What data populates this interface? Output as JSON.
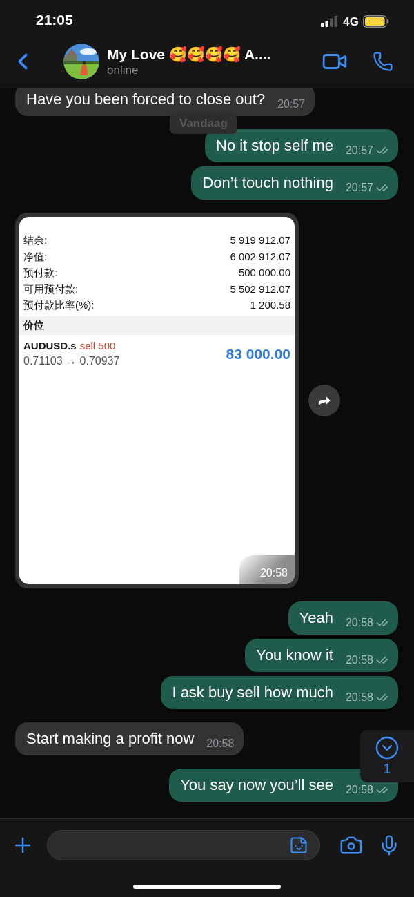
{
  "status_bar": {
    "time": "21:05",
    "network": "4G"
  },
  "header": {
    "name": "My Love 🥰🥰🥰🥰 A....",
    "status": "online"
  },
  "date_chip": "Vandaag",
  "messages": [
    {
      "kind": "text",
      "outgoing": false,
      "text": "Have you been forced to close out?",
      "time": "20:57"
    },
    {
      "kind": "text",
      "outgoing": true,
      "text": "No it stop self me",
      "time": "20:57",
      "read": false
    },
    {
      "kind": "text",
      "outgoing": true,
      "text": "Don’t touch nothing",
      "time": "20:57",
      "read": false
    },
    {
      "outgoing": false,
      "time": "20:58",
      "rows": [
        {
          "label": "结余:",
          "value": "5 919 912.07"
        },
        {
          "label": "净值:",
          "value": "6 002 912.07"
        },
        {
          "label": "预付款:",
          "value": "500 000.00"
        },
        {
          "label": "可用预付款:",
          "value": "5 502 912.07"
        },
        {
          "label": "预付款比率(%):",
          "value": "1 200.58"
        }
      ],
      "section": "价位",
      "position": {
        "symbol": "AUDUSD.s",
        "order": "sell 500",
        "prices": "0.71103 → 0.70937",
        "profit": "83 000.00"
      }
    },
    {
      "kind": "text",
      "outgoing": true,
      "text": "Yeah",
      "time": "20:58",
      "read": false
    },
    {
      "kind": "text",
      "outgoing": true,
      "text": "You know it",
      "time": "20:58",
      "read": false
    },
    {
      "kind": "text",
      "outgoing": true,
      "text": "I ask buy sell how much",
      "time": "20:58",
      "read": false
    },
    {
      "kind": "text",
      "outgoing": false,
      "text": "Start making a profit now",
      "time": "20:58"
    },
    {
      "kind": "text",
      "outgoing": true,
      "text": "You say now you’ll see",
      "time": "20:58",
      "read": false
    }
  ],
  "scroll_button": {
    "count": "1"
  }
}
